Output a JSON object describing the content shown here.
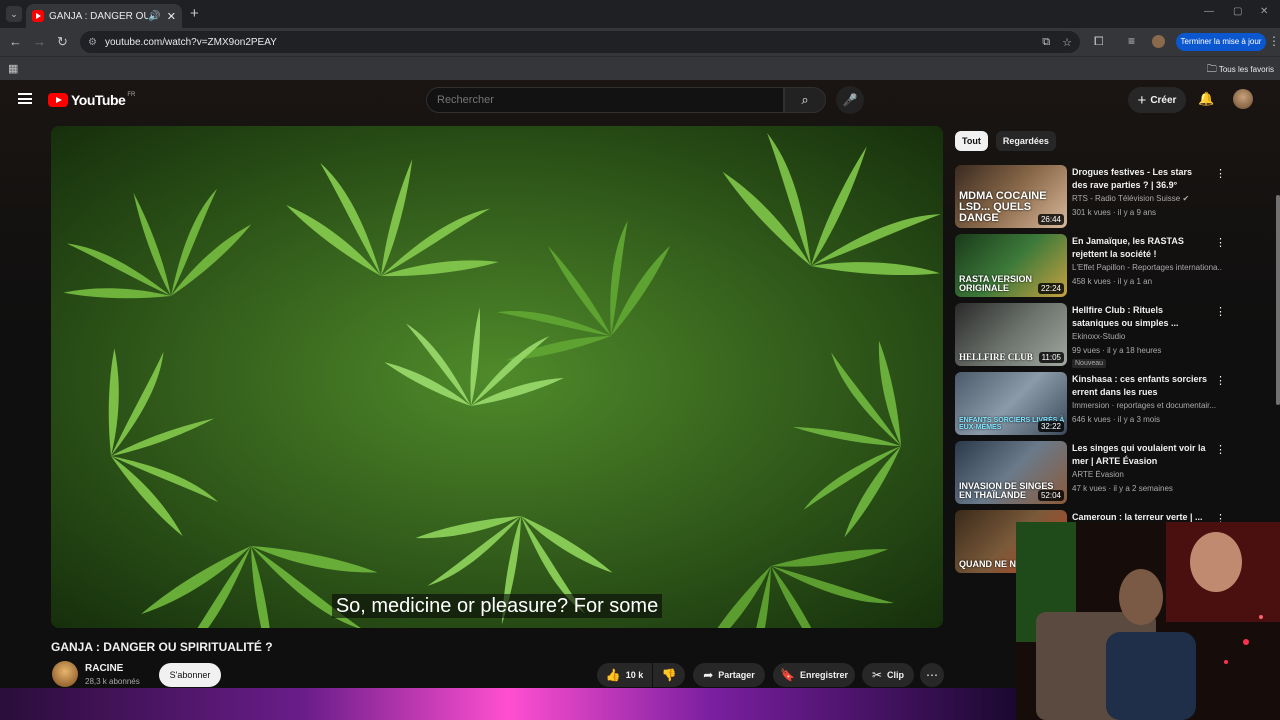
{
  "browser": {
    "tab_title": "GANJA : DANGER OU SPIRITUALITÉ ?",
    "url": "youtube.com/watch?v=ZMX9on2PEAY",
    "update_button": "Terminer la mise à jour",
    "bookmarks_all": "Tous les favoris"
  },
  "youtube": {
    "logo_text": "YouTube",
    "country_code": "FR",
    "search_placeholder": "Rechercher",
    "create_label": "Créer"
  },
  "video": {
    "subtitle": "So, medicine or pleasure?  For some",
    "title": "GANJA : DANGER OU SPIRITUALITÉ ?",
    "channel": "RACINE",
    "subscribers": "28,3 k abonnés",
    "subscribe_label": "S'abonner",
    "likes": "10 k",
    "share_label": "Partager",
    "save_label": "Enregistrer",
    "clip_label": "Clip"
  },
  "filters": {
    "all": "Tout",
    "watched": "Regardées"
  },
  "recommendations": [
    {
      "title": "Drogues festives - Les stars des rave parties ? | 36.9°",
      "channel": "RTS - Radio Télévision Suisse",
      "meta": "301 k vues · il y a 9 ans",
      "duration": "26:44",
      "thumb_text": "MDMA COCAINE LSD... QUELS DANGE",
      "color": "#8a6a4a"
    },
    {
      "title": "En Jamaïque, les RASTAS rejettent la société !",
      "channel": "L'Effet Papillon - Reportages internationa...",
      "meta": "458 k vues · il y a 1 an",
      "duration": "22:24",
      "thumb_text": "RASTA VERSION ORIGINALE",
      "color": "#3d7a3a"
    },
    {
      "title": "Hellfire Club : Rituels sataniques ou simples ...",
      "channel": "Ekinoxx-Studio",
      "meta": "99 vues · il y a 18 heures",
      "duration": "11:05",
      "thumb_text": "HELLFIRE CLUB",
      "badge": "Nouveau",
      "color": "#555a55"
    },
    {
      "title": "Kinshasa : ces enfants sorciers errent dans les rues",
      "channel": "Immersion · reportages et documentair...",
      "meta": "646 k vues · il y a 3 mois",
      "duration": "32:22",
      "thumb_text": "ENFANTS SORCIERS LIVRÉS À EUX-MÊMES",
      "color": "#6a7a8a"
    },
    {
      "title": "Les singes qui voulaient voir la mer | ARTE Évasion",
      "channel": "ARTE Évasion",
      "meta": "47 k vues · il y a 2 semaines",
      "duration": "52:04",
      "thumb_text": "INVASION DE SINGES EN THAÏLANDE",
      "color": "#4a5a6a"
    },
    {
      "title": "Cameroun : la terreur verte | ...",
      "channel": "",
      "meta": "",
      "duration": "",
      "thumb_text": "QUAND NE NOU",
      "color": "#5a4a3a"
    }
  ]
}
